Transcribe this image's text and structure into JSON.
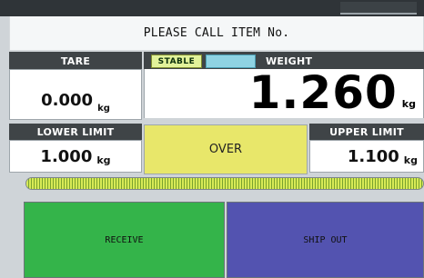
{
  "message": "PLEASE CALL ITEM No.",
  "tare": {
    "label": "TARE",
    "value": "0.000",
    "unit": "kg"
  },
  "weight": {
    "label": "WEIGHT",
    "value": "1.260",
    "unit": "kg",
    "stable_label": "STABLE"
  },
  "lower_limit": {
    "label": "LOWER LIMIT",
    "value": "1.000",
    "unit": "kg"
  },
  "upper_limit": {
    "label": "UPPER LIMIT",
    "value": "1.100",
    "unit": "kg"
  },
  "status": "OVER",
  "level_fill_fraction": 1.0,
  "buttons": {
    "receive": "RECEIVE",
    "ship_out": "SHIP OUT"
  },
  "colors": {
    "status_over": "#e8e76a",
    "receive": "#34b44a",
    "ship_out": "#5353b0",
    "stable": "#e2f29a",
    "indicator": "#8fd3e3"
  }
}
